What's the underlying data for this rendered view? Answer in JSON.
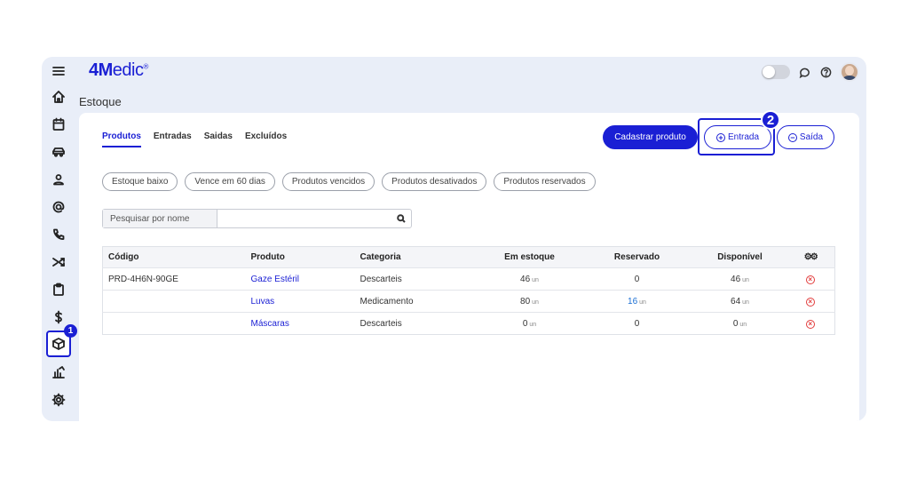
{
  "header": {
    "logo_bold": "4M",
    "logo_rest": "edic",
    "logo_mark": "®",
    "toggle_state": "off"
  },
  "sidebar": {
    "active": "produtos",
    "step_badge": "1",
    "icons": [
      "menu-icon",
      "home-icon",
      "calendar-icon",
      "car-icon",
      "user-icon",
      "at-icon",
      "phone-icon",
      "shuffle-icon",
      "clipboard-icon",
      "dollar-icon",
      "box-icon",
      "chart-icon",
      "gear-icon"
    ]
  },
  "page": {
    "title": "Estoque"
  },
  "tabs": [
    {
      "label": "Produtos",
      "active": true
    },
    {
      "label": "Entradas",
      "active": false
    },
    {
      "label": "Saidas",
      "active": false
    },
    {
      "label": "Excluídos",
      "active": false
    }
  ],
  "actions": {
    "cadastrar_label": "Cadastrar produto",
    "entrada_label": "Entrada",
    "saida_label": "Saída",
    "step_badge": "2"
  },
  "filters": [
    "Estoque baixo",
    "Vence em 60 dias",
    "Produtos vencidos",
    "Produtos desativados",
    "Produtos reservados"
  ],
  "search": {
    "label": "Pesquisar por nome",
    "value": ""
  },
  "table": {
    "headers": [
      "Código",
      "Produto",
      "Categoria",
      "Em estoque",
      "Reservado",
      "Disponível"
    ],
    "unit": "un",
    "rows": [
      {
        "codigo": "PRD-4H6N-90GE",
        "produto": "Gaze Estéril",
        "categoria": "Descarteis",
        "estoque": "46",
        "reservado": "0",
        "disponivel": "46"
      },
      {
        "codigo": "",
        "produto": "Luvas",
        "categoria": "Medicamento",
        "estoque": "80",
        "reservado": "16",
        "disponivel": "64"
      },
      {
        "codigo": "",
        "produto": "Máscaras",
        "categoria": "Descarteis",
        "estoque": "0",
        "reservado": "0",
        "disponivel": "0"
      }
    ]
  },
  "colors": {
    "accent": "#1a1fd4",
    "danger": "#e23c3c",
    "background": "#e9eef8"
  }
}
